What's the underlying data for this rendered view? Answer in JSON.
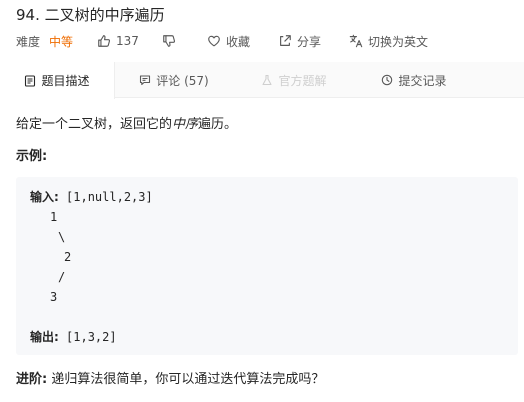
{
  "problem": {
    "title": "94. 二叉树的中序遍历"
  },
  "meta": {
    "difficulty_label": "难度",
    "difficulty_value": "中等",
    "likes": "137",
    "favorite_label": "收藏",
    "share_label": "分享",
    "switch_lang_label": "切换为英文"
  },
  "tabs": [
    {
      "label": "题目描述",
      "icon": "document-icon",
      "active": true
    },
    {
      "label": "评论 (57)",
      "icon": "comment-icon",
      "active": false
    },
    {
      "label": "官方题解",
      "icon": "flask-icon",
      "active": false,
      "disabled": true
    },
    {
      "label": "提交记录",
      "icon": "clock-icon",
      "active": false
    }
  ],
  "content": {
    "description_prefix": "给定一个二叉树，返回它的",
    "description_emphasis": "中序",
    "description_suffix": "遍历。",
    "example_heading": "示例:",
    "example": {
      "input_label": "输入:",
      "input_value": " [1,null,2,3]",
      "tree_lines": [
        "1",
        "\\",
        "2",
        "/",
        "3"
      ],
      "output_label": "输出:",
      "output_value": " [1,3,2]"
    },
    "advanced_label": "进阶:",
    "advanced_text": " 递归算法很简单，你可以通过迭代算法完成吗？"
  },
  "colors": {
    "difficulty_medium": "#ef6c00",
    "text_primary": "#262626",
    "text_secondary": "#595959",
    "tab_bar_bg": "#fafafa",
    "code_bg": "#f7f8fa"
  }
}
